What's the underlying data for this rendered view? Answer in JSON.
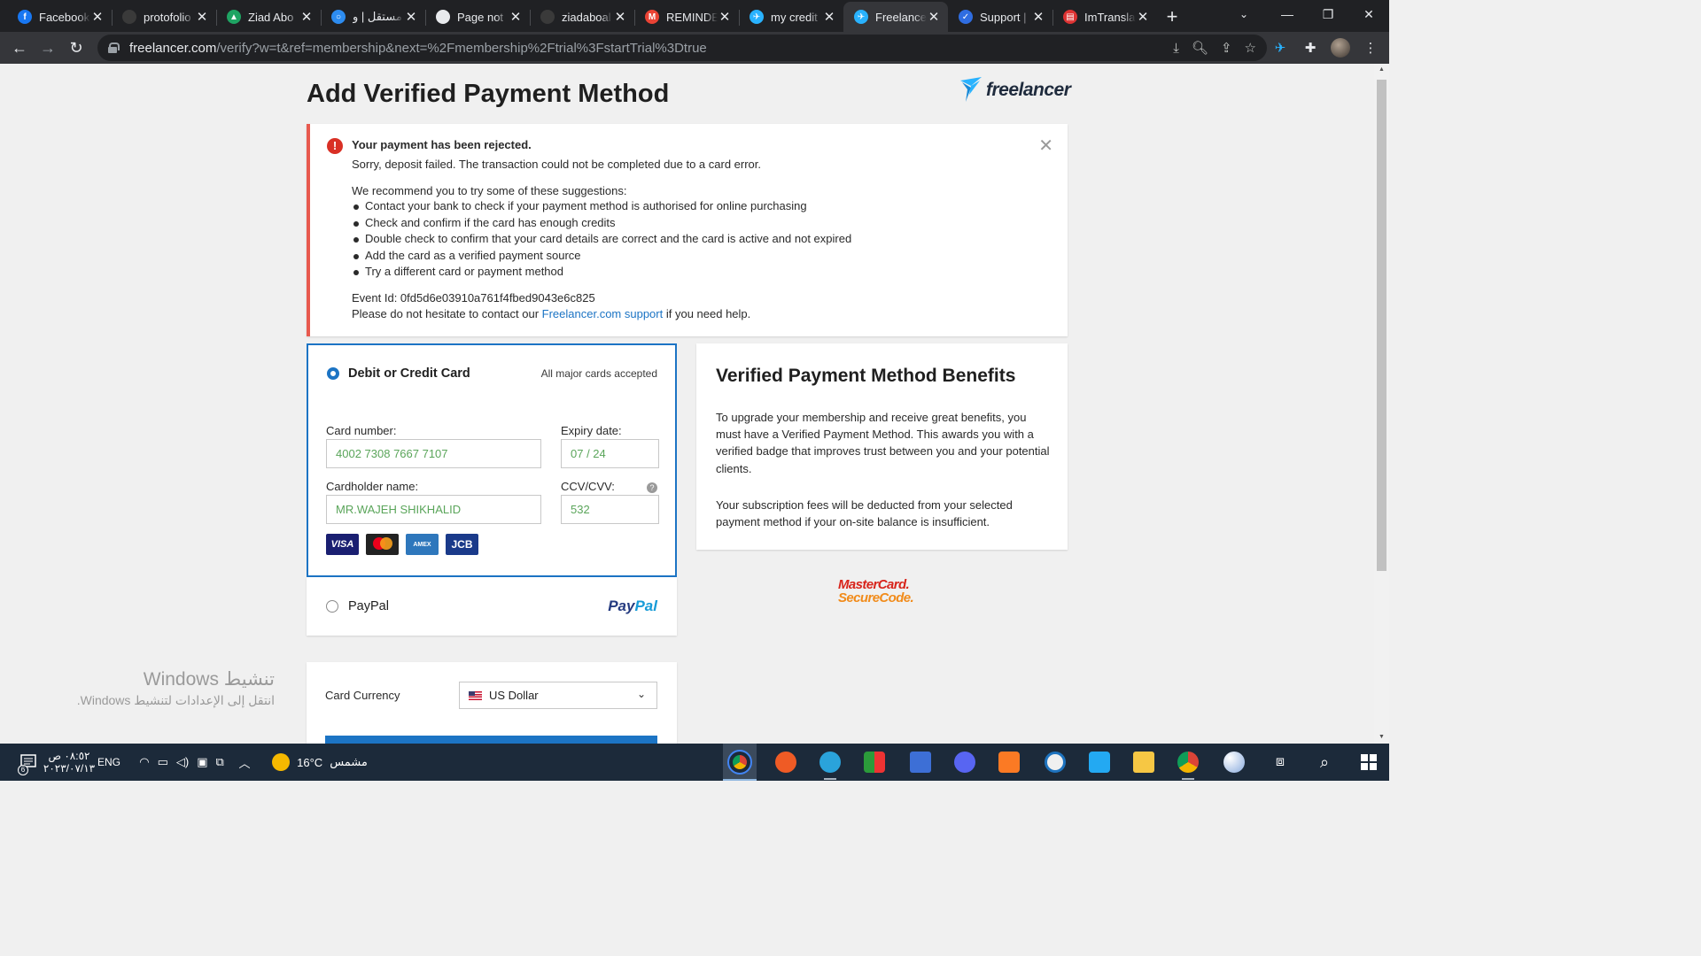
{
  "browser": {
    "tabs": [
      {
        "title": "Facebook",
        "icon": "facebook-icon",
        "color": "#1877f2",
        "glyph": "f"
      },
      {
        "title": "protofolio",
        "icon": "github-icon",
        "color": "#3a3a3a",
        "glyph": ""
      },
      {
        "title": "Ziad Abo",
        "icon": "google-drive-icon",
        "color": "#1fa463",
        "glyph": "▲"
      },
      {
        "title": "مستقل | و",
        "icon": "mostaql-icon",
        "color": "#2d8cf0",
        "glyph": "○"
      },
      {
        "title": "Page not",
        "icon": "globe-icon",
        "color": "#e8eaed",
        "glyph": ""
      },
      {
        "title": "ziadaboal",
        "icon": "github-icon",
        "color": "#3a3a3a",
        "glyph": ""
      },
      {
        "title": "REMINDE",
        "icon": "gmail-icon",
        "color": "#ea4335",
        "glyph": "M"
      },
      {
        "title": "my credit",
        "icon": "freelancer-icon",
        "color": "#29b2fe",
        "glyph": "✈"
      },
      {
        "title": "Freelance",
        "icon": "freelancer-icon",
        "color": "#29b2fe",
        "glyph": "✈"
      },
      {
        "title": "Support |",
        "icon": "support-icon",
        "color": "#2f6de1",
        "glyph": "✓"
      },
      {
        "title": "ImTransla",
        "icon": "imtranslator-icon",
        "color": "#d33",
        "glyph": "▤"
      }
    ],
    "url_host": "freelancer.com",
    "url_path": "/verify?w=t&ref=membership&next=%2Fmembership%2Ftrial%3FstartTrial%3Dtrue"
  },
  "page": {
    "title": "Add Verified Payment Method",
    "brand": "freelancer",
    "alert": {
      "heading": "Your payment has been rejected.",
      "message": "Sorry, deposit failed. The transaction could not be completed due to a card error.",
      "intro": "We recommend you to try some of these suggestions:",
      "suggestions": [
        "Contact your bank to check if your payment method is authorised for online purchasing",
        "Check and confirm if the card has enough credits",
        "Double check to confirm that your card details are correct and the card is active and not expired",
        "Add the card as a verified payment source",
        "Try a different card or payment method"
      ],
      "event_id": "Event Id: 0fd5d6e03910a761f4fbed9043e6c825",
      "contact_prefix": "Please do not hesitate to contact our",
      "contact_link": "Freelancer.com support",
      "contact_suffix": "if you need help."
    },
    "card_option": {
      "title": "Debit or Credit Card",
      "note": "All major cards accepted",
      "card_number_label": "Card number:",
      "card_number_value": "4002 7308 7667 7107",
      "expiry_label": "Expiry date:",
      "expiry_value": "07 / 24",
      "holder_label": "Cardholder name:",
      "holder_value": "MR.WAJEH SHIKHALID",
      "cvv_label": "CCV/CVV:",
      "cvv_value": "532",
      "logos": [
        "VISA",
        "",
        "AMEX",
        "JCB"
      ]
    },
    "paypal_option": {
      "label": "PayPal",
      "logo_a": "Pay",
      "logo_b": "Pal"
    },
    "benefits": {
      "title": "Verified Payment Method Benefits",
      "p1": "To upgrade your membership and receive great benefits, you must have a Verified Payment Method. This awards you with a verified badge that improves trust between you and your potential clients.",
      "p2": "Your subscription fees will be deducted from your selected payment method if your on-site balance is insufficient."
    },
    "securecode": {
      "line1": "MasterCard.",
      "line2": "SecureCode."
    },
    "currency": {
      "label": "Card Currency",
      "value": "US Dollar"
    }
  },
  "watermark": {
    "line1": "تنشيط Windows",
    "line2": "انتقل إلى الإعدادات لتنشيط Windows."
  },
  "taskbar": {
    "notif_count": "6",
    "time": "٠٨:٥٢ ص",
    "date": "٢٠٢٣/٠٧/١٣",
    "lang": "ENG",
    "weather_temp": "16°C",
    "weather_text": "مشمس"
  },
  "colors": {
    "accent": "#1c74c4",
    "alert_border": "#e85a4f",
    "field_text": "#5aa55a"
  }
}
